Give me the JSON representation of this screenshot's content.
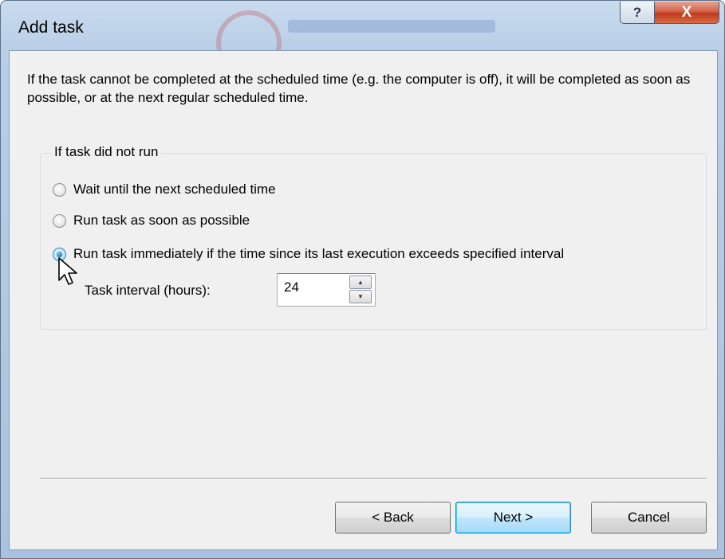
{
  "window": {
    "title": "Add task",
    "help_glyph": "?",
    "close_glyph": "X"
  },
  "intro_text": "If the task cannot be completed at the scheduled time (e.g. the computer is off), it will be completed as soon as possible, or at the next regular scheduled time.",
  "group": {
    "label": "If task did not run",
    "options": [
      {
        "label": "Wait until the next scheduled time",
        "checked": false
      },
      {
        "label": "Run task as soon as possible",
        "checked": false
      },
      {
        "label": "Run task immediately if the time since its last execution exceeds specified interval",
        "checked": true
      }
    ],
    "interval_label": "Task interval (hours):",
    "interval_value": "24",
    "spin_up_glyph": "▲",
    "spin_down_glyph": "▼"
  },
  "buttons": {
    "back": "< Back",
    "next": "Next >",
    "cancel": "Cancel"
  },
  "colors": {
    "accent": "#3c7fb1",
    "close_red": "#c0391c"
  }
}
